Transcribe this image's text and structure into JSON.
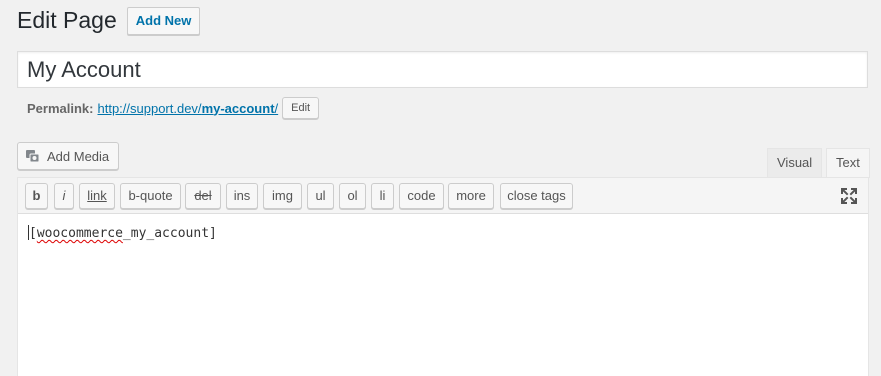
{
  "header": {
    "title": "Edit Page",
    "add_new_label": "Add New"
  },
  "post": {
    "title_value": "My Account"
  },
  "permalink": {
    "label": "Permalink:",
    "url_base": "http://support.dev/",
    "slug": "my-account",
    "url_suffix": "/",
    "edit_label": "Edit"
  },
  "media": {
    "add_media_label": "Add Media",
    "icon": "media-camera-icon"
  },
  "editor": {
    "tabs": [
      {
        "label": "Visual",
        "active": false
      },
      {
        "label": "Text",
        "active": true
      }
    ],
    "quicktags": [
      {
        "label": "b"
      },
      {
        "label": "i"
      },
      {
        "label": "link"
      },
      {
        "label": "b-quote"
      },
      {
        "label": "del"
      },
      {
        "label": "ins"
      },
      {
        "label": "img"
      },
      {
        "label": "ul"
      },
      {
        "label": "ol"
      },
      {
        "label": "li"
      },
      {
        "label": "code"
      },
      {
        "label": "more"
      },
      {
        "label": "close tags"
      }
    ],
    "fullscreen_icon": "fullscreen-icon",
    "content_open": "[",
    "content_misspelled": "woocommerce",
    "content_rest": "_my_account]"
  },
  "colors": {
    "link": "#0073aa",
    "background": "#f1f1f1",
    "spellcheck": "#dd0000"
  }
}
